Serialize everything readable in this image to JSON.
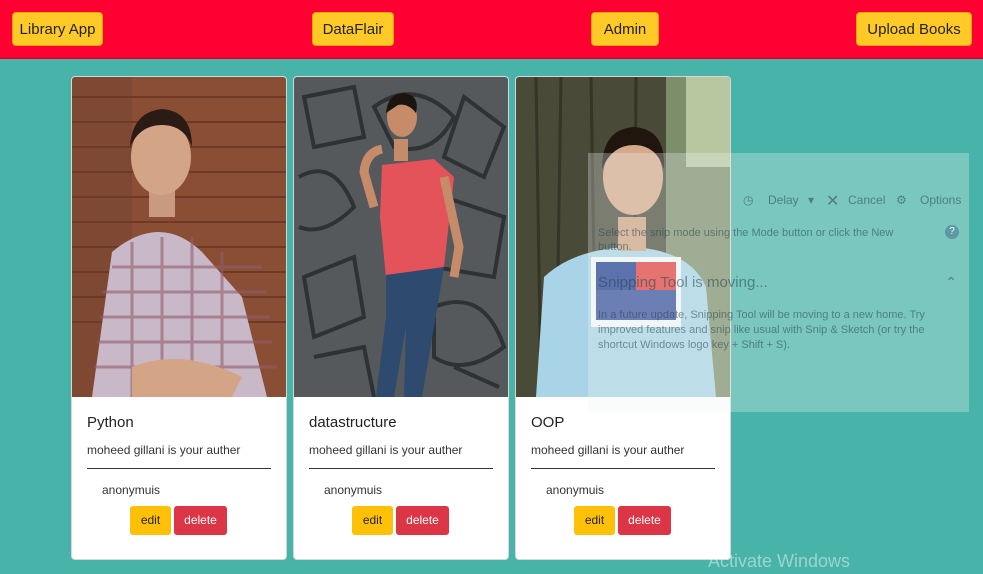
{
  "navbar": {
    "brand": "Library App",
    "center": "DataFlair",
    "admin": "Admin",
    "upload": "Upload Books"
  },
  "books": [
    {
      "title": "Python",
      "description": "moheed gillani is your auther",
      "author": "anonymuis",
      "edit_label": "edit",
      "delete_label": "delete"
    },
    {
      "title": "datastructure",
      "description": "moheed gillani is your auther",
      "author": "anonymuis",
      "edit_label": "edit",
      "delete_label": "delete"
    },
    {
      "title": "OOP",
      "description": "moheed gillani is your auther",
      "author": "anonymuis",
      "edit_label": "edit",
      "delete_label": "delete"
    }
  ],
  "snipping_tool": {
    "delay": "Delay",
    "cancel": "Cancel",
    "options": "Options",
    "description": "Select the snip mode using the Mode button or click the New button.",
    "heading": "Snipping Tool is moving...",
    "body": "In a future update, Snipping Tool will be moving to a new home. Try improved features and snip like usual with Snip & Sketch (or try the shortcut Windows logo key + Shift + S)."
  },
  "watermark": "Activate Windows",
  "colors": {
    "page_bg": "#48b3a8",
    "navbar_bg": "#ff0033",
    "nav_button": "#ffc928",
    "edit_button": "#ffc107",
    "delete_button": "#dc3545"
  }
}
